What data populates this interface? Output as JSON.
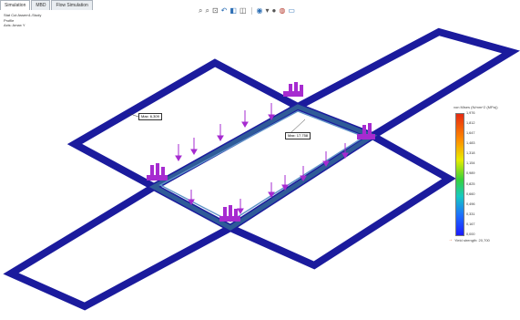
{
  "tabs": [
    "Simulation",
    "MBD",
    "Flow Simulation"
  ],
  "info": {
    "line1": "Stat Cut Assem1-Study",
    "line2": "Profile",
    "line3": "Axis: Amax Y"
  },
  "toolbar": [
    "search-icon",
    "zoom-fit-icon",
    "zoom-area-icon",
    "previous-view-icon",
    "section-view-icon",
    "view-orientation-icon",
    "display-style-icon",
    "hide-show-icon",
    "edit-appearance-icon",
    "scene-icon",
    "view-settings-icon"
  ],
  "callouts": {
    "max": "Max: 6,309",
    "min": "Max: 17,758"
  },
  "legend": {
    "title": "von Mises (N/mm^2 (MPa))",
    "ticks": [
      "1,976",
      "1,812",
      "1,647",
      "1,483",
      "1,318",
      "1,154",
      "0,989",
      "0,825",
      "0,660",
      "0,496",
      "0,331",
      "0,167",
      "0,000"
    ],
    "yield": "Yield strength: 20,700"
  },
  "colors": {
    "frame": "#1b1b9d",
    "support": "#2f5b98",
    "load": "#a62bd0",
    "accent": "#d64c1a"
  }
}
